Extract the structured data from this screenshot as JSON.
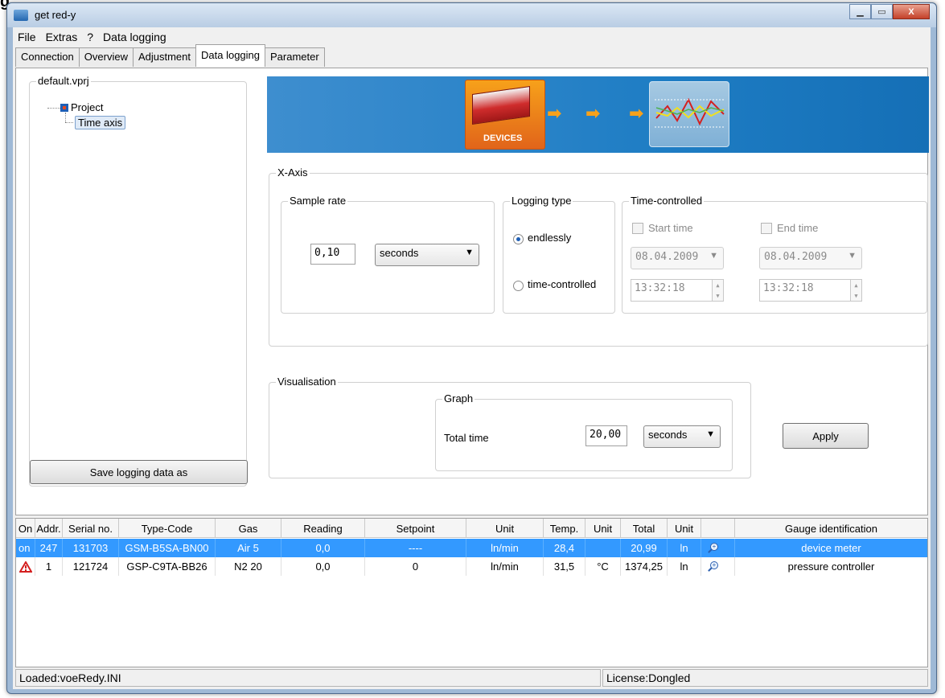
{
  "heading_fragment": "g",
  "window": {
    "title": "get red-y",
    "min_glyph": "▁",
    "max_glyph": "▭",
    "close_glyph": "X"
  },
  "menu": [
    "File",
    "Extras",
    "?",
    "Data logging"
  ],
  "tabs": [
    "Connection",
    "Overview",
    "Adjustment",
    "Data logging",
    "Parameter"
  ],
  "active_tab": "Data logging",
  "project_panel": {
    "legend": "default.vprj",
    "tree": {
      "root": "Project",
      "child": "Time axis"
    },
    "save_button": "Save logging data as"
  },
  "banner": {
    "devices_label": "DEVICES",
    "arrow_glyph": "➡"
  },
  "x_axis": {
    "legend": "X-Axis",
    "sample_rate": {
      "legend": "Sample rate",
      "value": "0,10",
      "unit": "seconds"
    },
    "logging_type": {
      "legend": "Logging type",
      "options": [
        "endlessly",
        "time-controlled"
      ],
      "selected": "endlessly"
    },
    "time_controlled": {
      "legend": "Time-controlled",
      "start_label": "Start time",
      "end_label": "End time",
      "start_date": "08.04.2009",
      "end_date": "08.04.2009",
      "start_time": "13:32:18",
      "end_time": "13:32:18"
    }
  },
  "visualisation": {
    "legend": "Visualisation",
    "graph": {
      "legend": "Graph",
      "total_time_label": "Total time",
      "total_time_value": "20,00",
      "unit": "seconds"
    }
  },
  "apply_button": "Apply",
  "devices_table": {
    "columns": [
      "On",
      "Addr.",
      "Serial no.",
      "Type-Code",
      "Gas",
      "Reading",
      "Setpoint",
      "Unit",
      "Temp.",
      "Unit",
      "Total",
      "Unit",
      "",
      "Gauge identification"
    ],
    "rows": [
      {
        "on": "on",
        "addr": "247",
        "serial": "131703",
        "type_code": "GSM-B5SA-BN00",
        "gas": "Air 5",
        "reading": "0,0",
        "setpoint": "----",
        "unit": "ln/min",
        "temp": "28,4",
        "temp_unit": "",
        "total": "20,99",
        "total_unit": "ln",
        "gauge_id": "device meter",
        "selected": true
      },
      {
        "on": "warning",
        "addr": "1",
        "serial": "121724",
        "type_code": "GSP-C9TA-BB26",
        "gas": "N2 20",
        "reading": "0,0",
        "setpoint": "0",
        "unit": "ln/min",
        "temp": "31,5",
        "temp_unit": "°C",
        "total": "1374,25",
        "total_unit": "ln",
        "gauge_id": "pressure controller",
        "selected": false
      }
    ]
  },
  "status": {
    "left": "Loaded:voeRedy.INI",
    "right": "License:Dongled"
  },
  "colors": {
    "selection": "#3399ff",
    "banner": "#1e7dc4",
    "devices_orange": "#f7a11a",
    "warning_red": "#d42020"
  }
}
